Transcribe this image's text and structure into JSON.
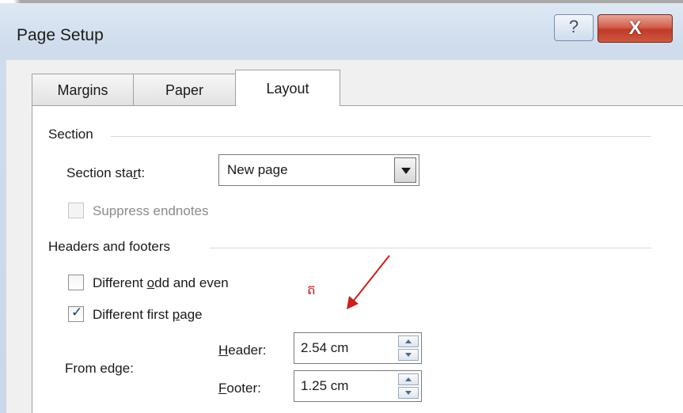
{
  "window": {
    "title": "Page Setup",
    "help_glyph": "?",
    "close_glyph": "X"
  },
  "tabs": [
    {
      "label": "Margins",
      "active": false
    },
    {
      "label": "Paper",
      "active": false
    },
    {
      "label": "Layout",
      "active": true
    }
  ],
  "section": {
    "group_title": "Section",
    "start_label_pre": "Section sta",
    "start_label_underline": "r",
    "start_label_post": "t:",
    "start_value": "New page",
    "suppress_endnotes_label": "Suppress endnotes",
    "suppress_endnotes_checked": false,
    "suppress_endnotes_enabled": false
  },
  "headers_footers": {
    "group_title": "Headers and footers",
    "odd_even_pre": "Different ",
    "odd_even_underline": "o",
    "odd_even_post": "dd and even",
    "odd_even_checked": false,
    "first_page_pre": "Different first ",
    "first_page_underline": "p",
    "first_page_post": "age",
    "first_page_checked": true,
    "from_edge_label": "From edge:",
    "header_underline": "H",
    "header_post": "eader:",
    "header_value": "2.54 cm",
    "footer_underline": "F",
    "footer_post": "ooter:",
    "footer_value": "1.25 cm"
  },
  "annotation": {
    "char": "ត",
    "color": "#cc1f1f"
  },
  "check_glyph": "✓"
}
